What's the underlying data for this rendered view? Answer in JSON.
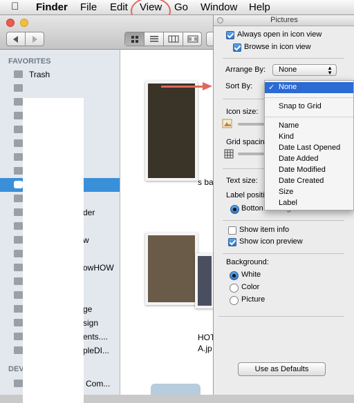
{
  "menubar": {
    "app_name": "Finder",
    "items": [
      "File",
      "Edit",
      "View",
      "Go",
      "Window",
      "Help"
    ]
  },
  "sidebar": {
    "favorites_heading": "FAVORITES",
    "first_item": "Trash",
    "devices_heading": "DEVI",
    "label_fragments": [
      "der",
      "w",
      "owHOW",
      "ge",
      "sign",
      "ents....",
      "pleDI...",
      "Com..."
    ]
  },
  "content": {
    "fragments": [
      "s ba",
      "HOT",
      "A.jp"
    ]
  },
  "panel": {
    "title": "Pictures",
    "always_icon_view": "Always open in icon view",
    "browse_icon_view": "Browse in icon view",
    "arrange_by_label": "Arrange By:",
    "arrange_by_value": "None",
    "sort_by_label": "Sort By:",
    "icon_size_label": "Icon size:",
    "grid_spacing_label": "Grid spacin",
    "text_size_label": "Text size:",
    "label_position_label": "Label positi",
    "label_position_option": "Botton",
    "label_position_option2": "ight",
    "show_item_info": "Show item info",
    "show_icon_preview": "Show icon preview",
    "background_label": "Background:",
    "bg_white": "White",
    "bg_color": "Color",
    "bg_picture": "Picture",
    "defaults_button": "Use as Defaults"
  },
  "sort_menu": {
    "selected": "None",
    "check": "✓",
    "snap": "Snap to Grid",
    "options": [
      "Name",
      "Kind",
      "Date Last Opened",
      "Date Added",
      "Date Modified",
      "Date Created",
      "Size",
      "Label"
    ]
  },
  "colors": {
    "selection": "#2c6ad4",
    "annotation": "#e0685a",
    "sidebar": "#e3e8ee"
  }
}
